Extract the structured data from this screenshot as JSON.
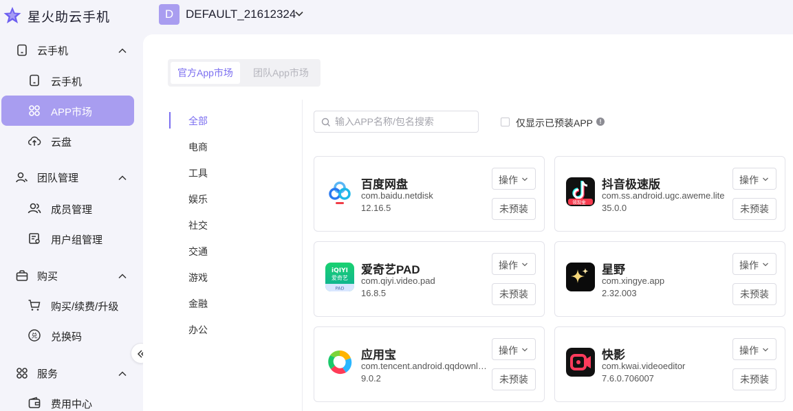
{
  "app": {
    "title": "星火助云手机"
  },
  "workspace": {
    "avatar_letter": "D",
    "name": "DEFAULT_21612324"
  },
  "sidebar": {
    "groups": [
      {
        "label": "云手机",
        "items": [
          {
            "label": "云手机"
          },
          {
            "label": "APP市场"
          },
          {
            "label": "云盘"
          }
        ]
      },
      {
        "label": "团队管理",
        "items": [
          {
            "label": "成员管理"
          },
          {
            "label": "用户组管理"
          }
        ]
      },
      {
        "label": "购买",
        "items": [
          {
            "label": "购买/续费/升级"
          },
          {
            "label": "兑换码"
          }
        ]
      },
      {
        "label": "服务",
        "items": [
          {
            "label": "费用中心"
          }
        ]
      }
    ]
  },
  "market_tabs": [
    {
      "label": "官方App市场"
    },
    {
      "label": "团队App市场"
    }
  ],
  "categories": [
    "全部",
    "电商",
    "工具",
    "娱乐",
    "社交",
    "交通",
    "游戏",
    "金融",
    "办公"
  ],
  "search": {
    "placeholder": "输入APP名称/包名搜索"
  },
  "filter": {
    "preinstalled_label": "仅显示已预装APP",
    "info_glyph": "!"
  },
  "apps": [
    {
      "name": "百度网盘",
      "package": "com.baidu.netdisk",
      "version": "12.16.5",
      "action_label": "操作",
      "status_label": "未预装"
    },
    {
      "name": "抖音极速版",
      "package": "com.ss.android.ugc.aweme.lite",
      "version": "35.0.0",
      "action_label": "操作",
      "status_label": "未预装",
      "icon_badge": "领现金"
    },
    {
      "name": "爱奇艺PAD",
      "package": "com.qiyi.video.pad",
      "version": "16.8.5",
      "action_label": "操作",
      "status_label": "未预装",
      "icon_text": [
        "iQIYI",
        "爱奇艺",
        "PAD"
      ]
    },
    {
      "name": "星野",
      "package": "com.xingye.app",
      "version": "2.32.003",
      "action_label": "操作",
      "status_label": "未预装"
    },
    {
      "name": "应用宝",
      "package": "com.tencent.android.qqdownloader",
      "version": "9.0.2",
      "action_label": "操作",
      "status_label": "未预装"
    },
    {
      "name": "快影",
      "package": "com.kwai.videoeditor",
      "version": "7.6.0.706007",
      "action_label": "操作",
      "status_label": "未预装"
    }
  ],
  "colors": {
    "accent": "#7b6ef0",
    "active_nav": "#a89df0",
    "annotation_arrow": "#e5484d"
  }
}
